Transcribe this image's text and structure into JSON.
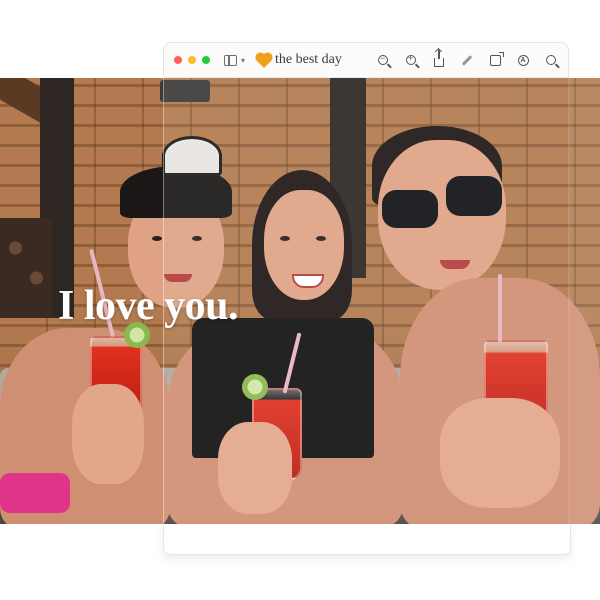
{
  "window": {
    "title": "the best day",
    "title_icon": "heart-icon",
    "controls": [
      "close",
      "minimize",
      "zoom"
    ],
    "colors": {
      "close": "#fe5f57",
      "minimize": "#febc2e",
      "zoom": "#28c840",
      "heart": "#f0a11c"
    }
  },
  "toolbar": {
    "sidebar_icon": "sidebar-icon",
    "tools": [
      {
        "name": "zoom-out-icon"
      },
      {
        "name": "zoom-in-icon"
      },
      {
        "name": "share-icon"
      },
      {
        "name": "highlight-pen-icon"
      },
      {
        "name": "rotate-icon"
      },
      {
        "name": "markup-icon"
      },
      {
        "name": "search-icon"
      }
    ]
  },
  "photo": {
    "overlay_text": "I love you."
  }
}
